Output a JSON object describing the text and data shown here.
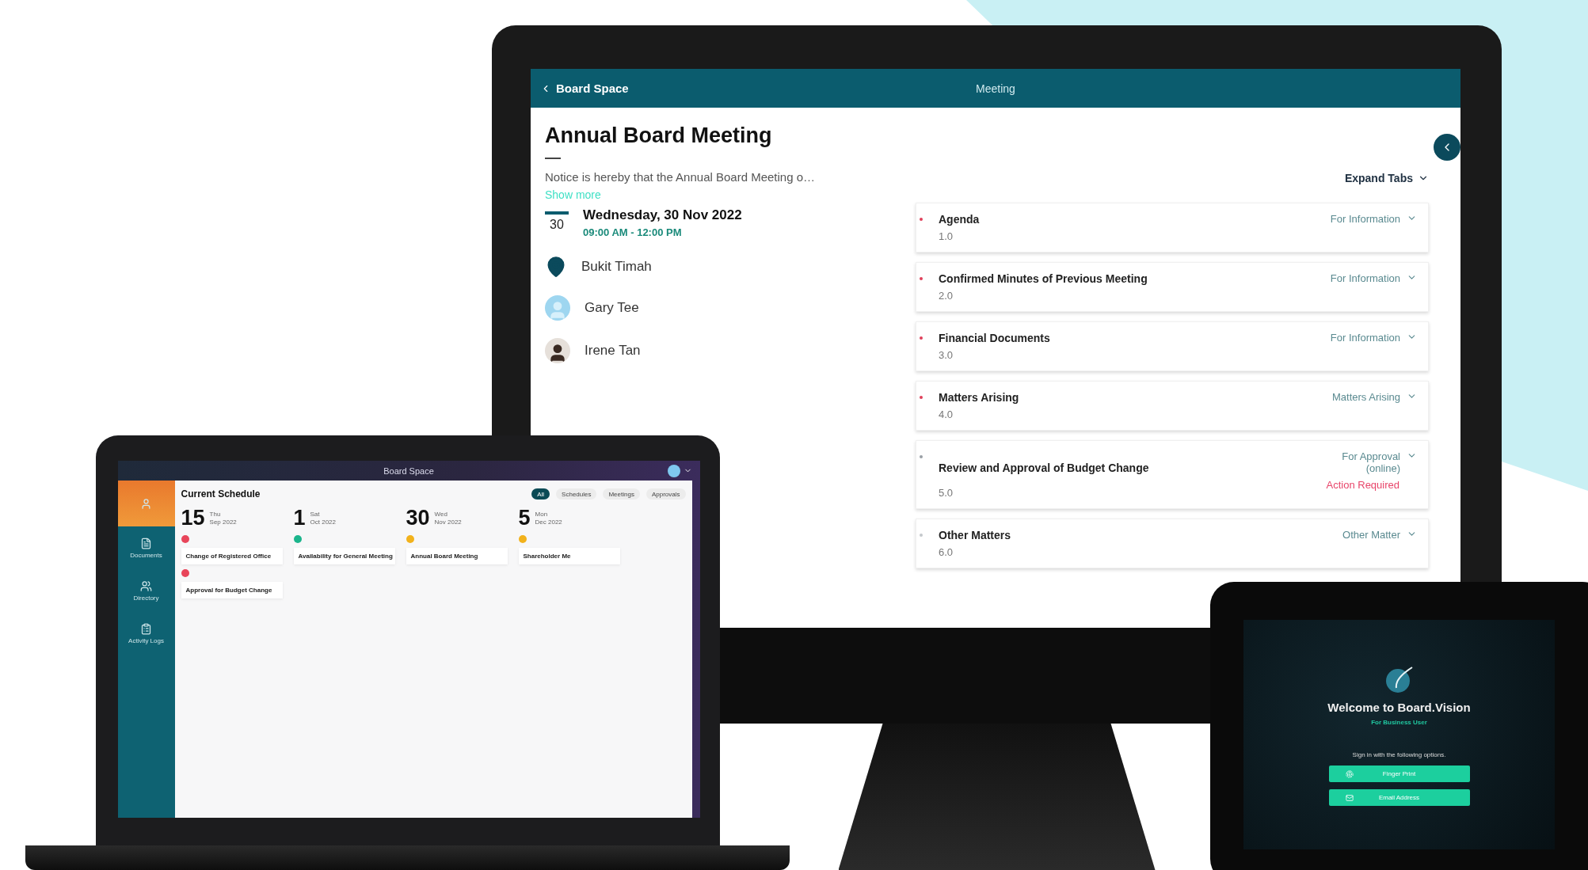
{
  "monitor": {
    "header": {
      "back_label": "Board Space",
      "title": "Meeting"
    },
    "meeting": {
      "title": "Annual Board Meeting",
      "notice": "Notice is hereby that the Annual Board Meeting o…",
      "show_more": "Show more",
      "date_day": "30",
      "date": "Wednesday, 30 Nov 2022",
      "time": "09:00 AM - 12:00 PM",
      "location": "Bukit Timah"
    },
    "attendees": [
      {
        "name": "Gary Tee",
        "kind": "placeholder"
      },
      {
        "name": "Irene Tan",
        "kind": "photo"
      }
    ],
    "expand_tabs": "Expand Tabs",
    "agenda": [
      {
        "title": "Agenda",
        "number": "1.0",
        "status": "For Information",
        "color": "#e0405a"
      },
      {
        "title": "Confirmed Minutes of Previous Meeting",
        "number": "2.0",
        "status": "For Information",
        "color": "#e0405a"
      },
      {
        "title": "Financial Documents",
        "number": "3.0",
        "status": "For Information",
        "color": "#e0405a"
      },
      {
        "title": "Matters Arising",
        "number": "4.0",
        "status": "Matters Arising",
        "color": "#e0405a"
      },
      {
        "title": "Review and Approval of Budget Change",
        "number": "5.0",
        "status": "For Approval (online)",
        "action": "Action Required",
        "color": "#9aa0a6"
      },
      {
        "title": "Other Matters",
        "number": "6.0",
        "status": "Other Matter",
        "color": "#c4c8cc"
      }
    ]
  },
  "laptop": {
    "title": "Board Space",
    "sidebar": [
      {
        "kind": "person",
        "selected": true
      },
      {
        "kind": "document",
        "label": "Documents",
        "selected": false
      },
      {
        "kind": "directory",
        "label": "Directory",
        "selected": false
      },
      {
        "kind": "log",
        "label": "Activity Logs",
        "selected": false
      }
    ],
    "heading": "Current Schedule",
    "filters": [
      {
        "label": "All",
        "selected": true
      },
      {
        "label": "Schedules",
        "selected": false
      },
      {
        "label": "Meetings",
        "selected": false
      },
      {
        "label": "Approvals",
        "selected": false
      }
    ],
    "days": [
      {
        "day": "15",
        "weekday": "Thu",
        "month": "Sep 2022",
        "events": [
          {
            "title": "Change of Registered Office",
            "color": "#e8455a"
          },
          {
            "title": "Approval for Budget Change",
            "color": "#e8455a"
          }
        ]
      },
      {
        "day": "1",
        "weekday": "Sat",
        "month": "Oct 2022",
        "events": [
          {
            "title": "Availability for General Meeting",
            "color": "#1bb58c"
          }
        ]
      },
      {
        "day": "30",
        "weekday": "Wed",
        "month": "Nov 2022",
        "events": [
          {
            "title": "Annual Board Meeting",
            "color": "#f2b21b"
          }
        ]
      },
      {
        "day": "5",
        "weekday": "Mon",
        "month": "Dec 2022",
        "events": [
          {
            "title": "Shareholder Me",
            "color": "#f2b21b"
          }
        ]
      }
    ]
  },
  "tablet": {
    "welcome": "Welcome to Board.Vision",
    "subtitle": "For Business User",
    "hint": "Sign in with the following options.",
    "buttons": [
      {
        "label": "Finger Print",
        "kind": "fingerprint"
      },
      {
        "label": "Email Address",
        "kind": "email"
      }
    ]
  }
}
